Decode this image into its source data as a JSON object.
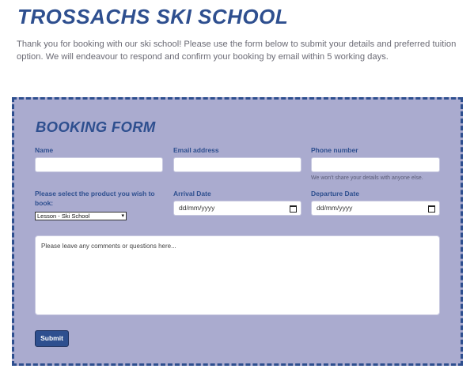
{
  "header": {
    "title": "TROSSACHS SKI SCHOOL",
    "intro": "Thank you for booking with our ski school! Please use the form below to submit your details and preferred tuition option. We will endeavour to respond and confirm your booking by email within 5 working days."
  },
  "form": {
    "title": "BOOKING FORM",
    "name_label": "Name",
    "name_value": "",
    "email_label": "Email address",
    "email_value": "",
    "phone_label": "Phone number",
    "phone_value": "",
    "phone_help": "We won't share your details with anyone else.",
    "product_label": "Please select the product you wish to book:",
    "product_selected": "Lesson - Ski School",
    "arrival_label": "Arrival Date",
    "arrival_placeholder": "dd/mm/yyyy",
    "departure_label": "Departure Date",
    "departure_placeholder": "dd/mm/yyyy",
    "comments_placeholder": "Please leave any comments or questions here...",
    "submit_label": "Submit"
  },
  "colors": {
    "brand": "#2e4f8f",
    "panel": "#aaabcf"
  }
}
